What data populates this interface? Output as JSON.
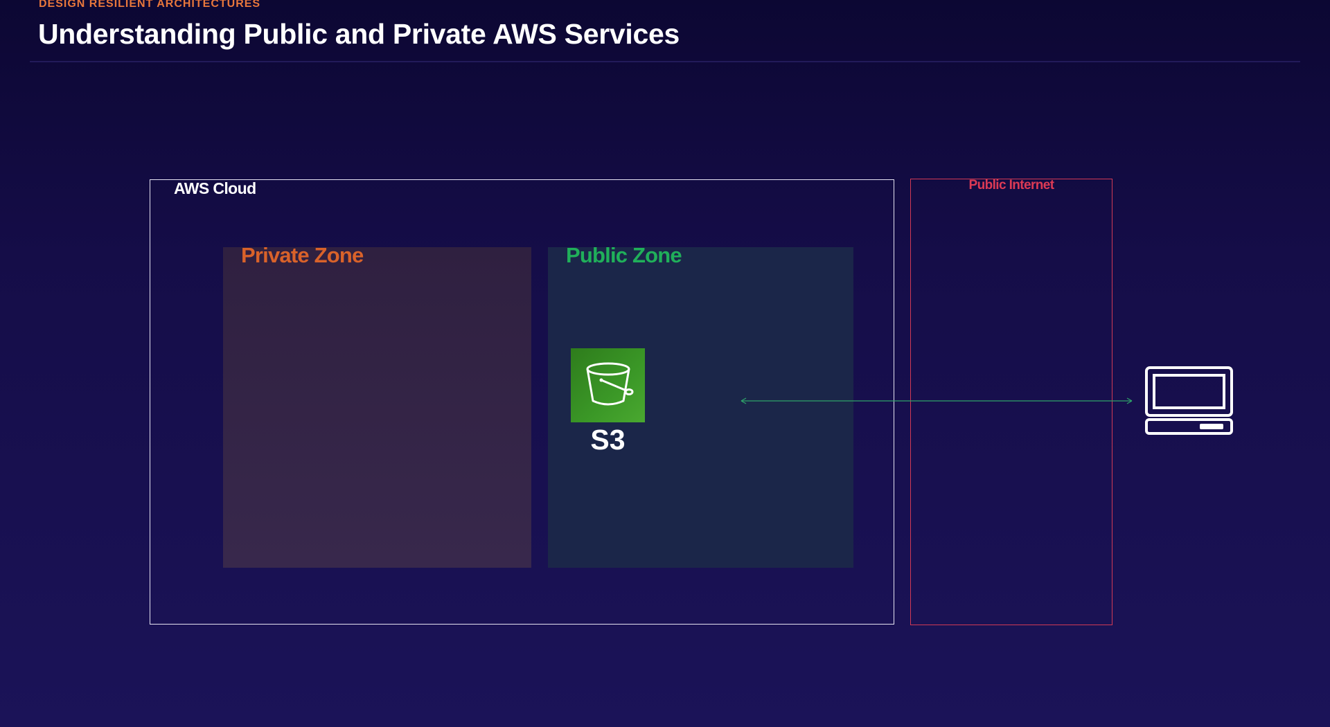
{
  "header": {
    "eyebrow": "DESIGN RESILIENT ARCHITECTURES",
    "title": "Understanding Public and Private AWS Services"
  },
  "diagram": {
    "aws_cloud_label": "AWS Cloud",
    "private_zone_label": "Private Zone",
    "public_zone_label": "Public Zone",
    "service_label": "S3",
    "public_internet_label": "Public Internet"
  },
  "colors": {
    "accent_orange": "#e8773c",
    "private_zone": "#d9622a",
    "public_zone": "#20b05a",
    "public_internet": "#dd3a55",
    "connector": "#2fa56a"
  },
  "icons": {
    "service": "s3-bucket-icon",
    "client": "laptop-icon"
  }
}
